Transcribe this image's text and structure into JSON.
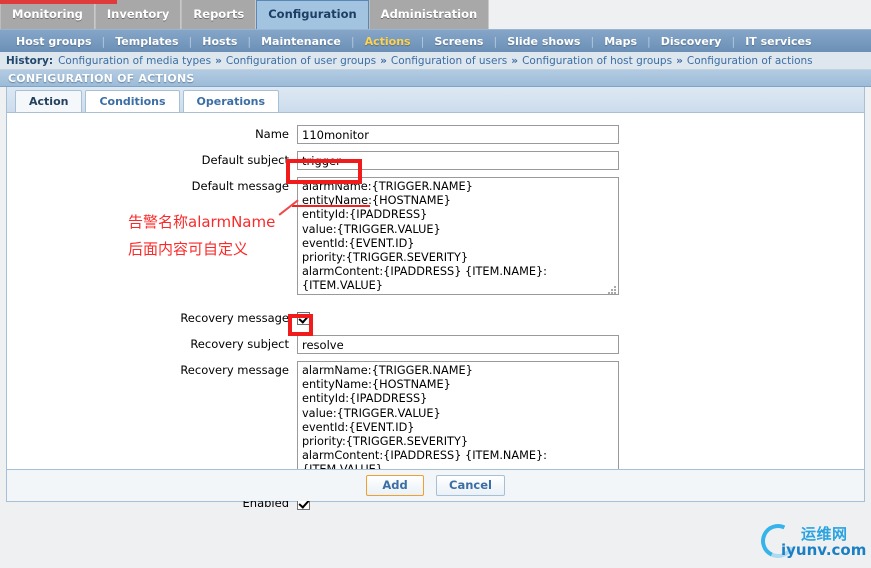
{
  "primary_menu": {
    "items": [
      {
        "label": "Monitoring",
        "selected": false
      },
      {
        "label": "Inventory",
        "selected": false
      },
      {
        "label": "Reports",
        "selected": false
      },
      {
        "label": "Configuration",
        "selected": true
      },
      {
        "label": "Administration",
        "selected": false
      }
    ]
  },
  "secondary_menu": {
    "items": [
      {
        "label": "Host groups",
        "selected": false
      },
      {
        "label": "Templates",
        "selected": false
      },
      {
        "label": "Hosts",
        "selected": false
      },
      {
        "label": "Maintenance",
        "selected": false
      },
      {
        "label": "Actions",
        "selected": true
      },
      {
        "label": "Screens",
        "selected": false
      },
      {
        "label": "Slide shows",
        "selected": false
      },
      {
        "label": "Maps",
        "selected": false
      },
      {
        "label": "Discovery",
        "selected": false
      },
      {
        "label": "IT services",
        "selected": false
      }
    ],
    "separator": "|"
  },
  "history": {
    "label": "History:",
    "separator": "»",
    "items": [
      "Configuration of media types",
      "Configuration of user groups",
      "Configuration of users",
      "Configuration of host groups",
      "Configuration of actions"
    ]
  },
  "page": {
    "title": "CONFIGURATION OF ACTIONS"
  },
  "form_tabs": [
    {
      "label": "Action",
      "selected": true
    },
    {
      "label": "Conditions",
      "selected": false
    },
    {
      "label": "Operations",
      "selected": false
    }
  ],
  "form": {
    "name": {
      "label": "Name",
      "value": "110monitor"
    },
    "default_subject": {
      "label": "Default subject",
      "value": "trigger"
    },
    "default_message": {
      "label": "Default message",
      "value": "alarmName:{TRIGGER.NAME}\nentityName:{HOSTNAME}\nentityId:{IPADDRESS}\nvalue:{TRIGGER.VALUE}\neventId:{EVENT.ID}\npriority:{TRIGGER.SEVERITY}\nalarmContent:{IPADDRESS} {ITEM.NAME}:\n{ITEM.VALUE}"
    },
    "recovery_message_toggle": {
      "label": "Recovery message",
      "checked": true
    },
    "recovery_subject": {
      "label": "Recovery subject",
      "value": "resolve"
    },
    "recovery_message": {
      "label": "Recovery message",
      "value": "alarmName:{TRIGGER.NAME}\nentityName:{HOSTNAME}\nentityId:{IPADDRESS}\nvalue:{TRIGGER.VALUE}\neventId:{EVENT.ID}\npriority:{TRIGGER.SEVERITY}\nalarmContent:{IPADDRESS} {ITEM.NAME}:\n{ITEM.VALUE}"
    },
    "enabled": {
      "label": "Enabled",
      "checked": true
    }
  },
  "buttons": {
    "add": "Add",
    "cancel": "Cancel"
  },
  "annotations": {
    "note_line1": "告警名称alarmName",
    "note_line2": "后面内容可自定义",
    "color": "#fa2a2a"
  },
  "watermark": {
    "cn": "运维网",
    "en": "iyunv.com"
  }
}
